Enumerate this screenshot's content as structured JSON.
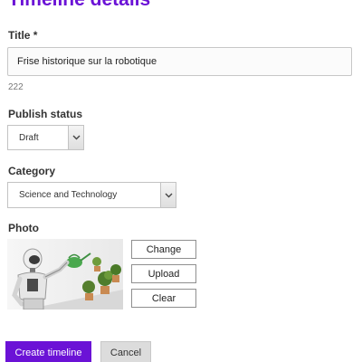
{
  "page": {
    "title": "Timeline details"
  },
  "title_field": {
    "label": "Title",
    "required_marker": "*",
    "value": "Frise historique sur la robotique",
    "char_count": "222"
  },
  "publish_status": {
    "label": "Publish status",
    "selected": "Draft"
  },
  "category": {
    "label": "Category",
    "selected": "Science and Technology"
  },
  "photo": {
    "label": "Photo",
    "change_label": "Change",
    "upload_label": "Upload",
    "clear_label": "Clear"
  },
  "actions": {
    "create_label": "Create timeline",
    "cancel_label": "Cancel"
  },
  "colors": {
    "accent": "#6b12d6",
    "cancel_bg": "#dcdcdc"
  },
  "icons": {
    "dropdown": "chevron-down-icon"
  }
}
